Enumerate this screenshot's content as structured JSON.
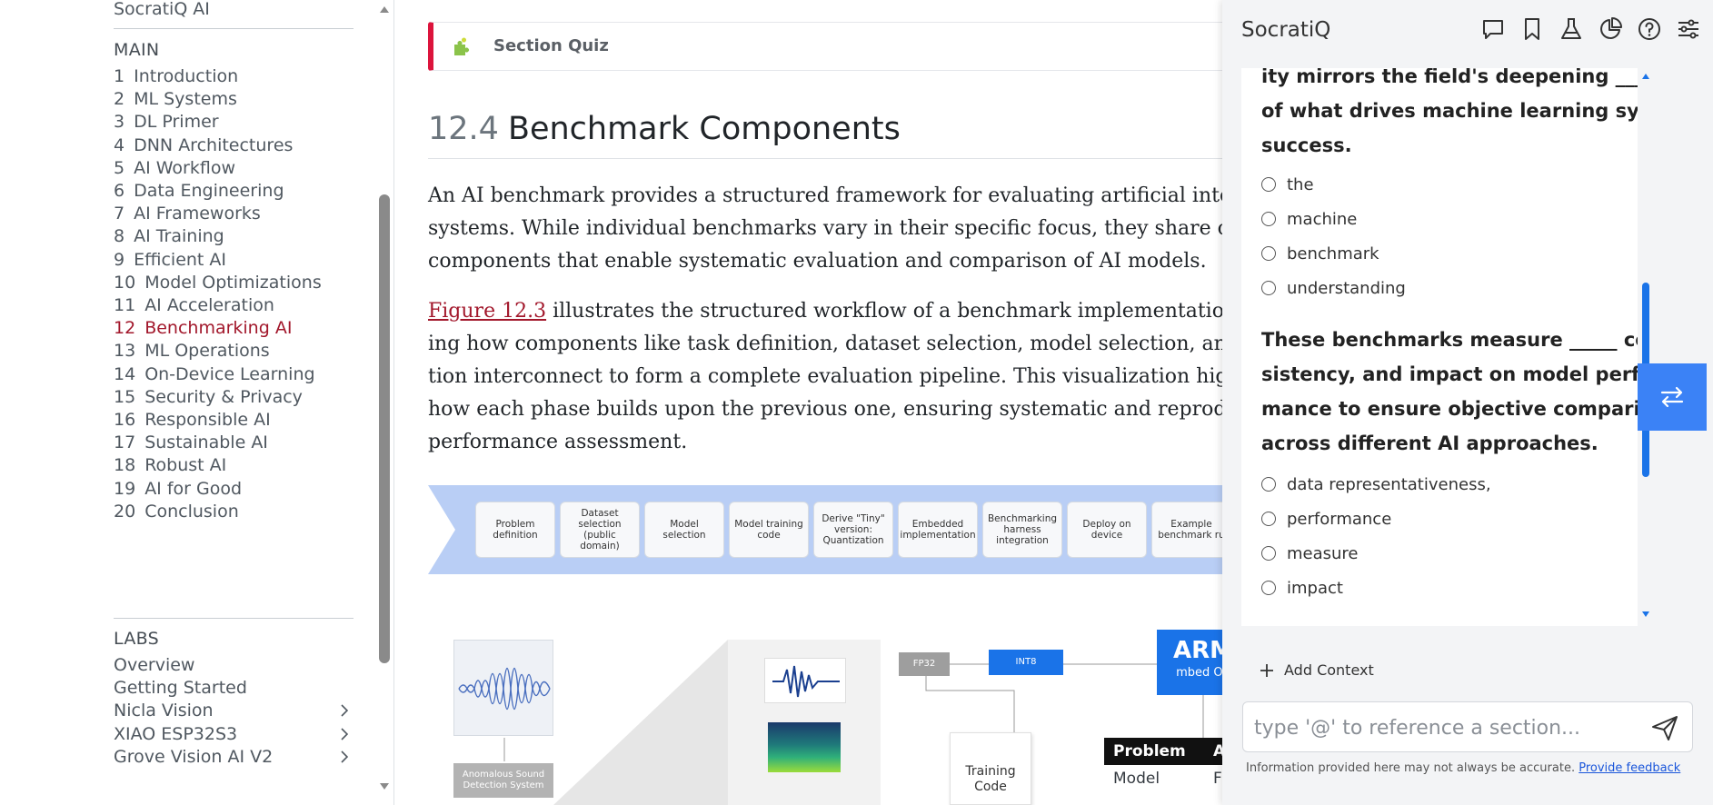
{
  "sidebar": {
    "title": "SocratiQ AI",
    "main_heading": "MAIN",
    "chapters": [
      {
        "num": "1",
        "label": "Introduction"
      },
      {
        "num": "2",
        "label": "ML Systems"
      },
      {
        "num": "3",
        "label": "DL Primer"
      },
      {
        "num": "4",
        "label": "DNN Architectures"
      },
      {
        "num": "5",
        "label": "AI Workflow"
      },
      {
        "num": "6",
        "label": "Data Engineering"
      },
      {
        "num": "7",
        "label": "AI Frameworks"
      },
      {
        "num": "8",
        "label": "AI Training"
      },
      {
        "num": "9",
        "label": "Efficient AI"
      },
      {
        "num": "10",
        "label": "Model Optimizations"
      },
      {
        "num": "11",
        "label": "AI Acceleration"
      },
      {
        "num": "12",
        "label": "Benchmarking AI"
      },
      {
        "num": "13",
        "label": "ML Operations"
      },
      {
        "num": "14",
        "label": "On-Device Learning"
      },
      {
        "num": "15",
        "label": "Security & Privacy"
      },
      {
        "num": "16",
        "label": "Responsible AI"
      },
      {
        "num": "17",
        "label": "Sustainable AI"
      },
      {
        "num": "18",
        "label": "Robust AI"
      },
      {
        "num": "19",
        "label": "AI for Good"
      },
      {
        "num": "20",
        "label": "Conclusion"
      }
    ],
    "active_chapter": "12",
    "labs_heading": "LABS",
    "labs": [
      {
        "label": "Overview"
      },
      {
        "label": "Getting Started"
      },
      {
        "label": "Nicla Vision"
      },
      {
        "label": "XIAO ESP32S3"
      },
      {
        "label": "Grove Vision AI V2"
      }
    ]
  },
  "main": {
    "callout_label": "Section Quiz",
    "section_number": "12.4",
    "section_title": "Benchmark Components",
    "para1": [
      "An AI benchmark provides a structured framework for evaluating artificial intelligen",
      "systems. While individual benchmarks vary in their specific focus, they share comm",
      "components that enable systematic evaluation and comparison of AI models."
    ],
    "para2_link": "Figure 12.3",
    "para2_first_rest": " illustrates the structured workflow of a benchmark implementation, sho",
    "para2": [
      "ing how components like task definition, dataset selection, model selection, and eva",
      "tion interconnect to form a complete evaluation pipeline. This visualization highligh",
      "how each phase builds upon the previous one, ensuring systematic and reproducible",
      "performance assessment."
    ],
    "workflow_steps": [
      "Problem definition",
      "Dataset selection (public domain)",
      "Model selection",
      "Model training code",
      "Derive \"Tiny\" version: Quantization",
      "Embedded implementation",
      "Benchmarking harness integration",
      "Deploy on device",
      "Example benchmark ru"
    ],
    "diagram": {
      "asd_label": "Anomalous Sound Detection System",
      "fp32": "FP32",
      "int8": "INT8",
      "arm_title": "ARM",
      "arm_sub": "mbed OS",
      "training_code": "Training Code",
      "table": [
        {
          "c1": "Problem",
          "c2": "AD"
        },
        {
          "c1": "Model",
          "c2": "FC-AE"
        }
      ]
    }
  },
  "socratiq": {
    "title": "SocratiQ",
    "icons": [
      "chat-icon",
      "bookmark-icon",
      "flask-icon",
      "pie-chart-icon",
      "help-icon",
      "settings-sliders-icon"
    ],
    "q1_lines": [
      "ity mirrors the field's deepening _____",
      "of what drives machine learning system",
      "success."
    ],
    "q1_options": [
      "the",
      "machine",
      "benchmark",
      "understanding"
    ],
    "q2_lines": [
      "These benchmarks measure _____ con-",
      "sistency, and impact on model perfor-",
      "mance to ensure objective comparisons",
      "across different AI approaches."
    ],
    "q2_options": [
      "data representativeness,",
      "performance",
      "measure",
      "impact"
    ],
    "add_context": "Add Context",
    "input_placeholder": "type '@' to reference a section...",
    "disclaimer": "Information provided here may not always be accurate.",
    "feedback_link": "Provide feedback",
    "accent": "#1a73e8"
  }
}
